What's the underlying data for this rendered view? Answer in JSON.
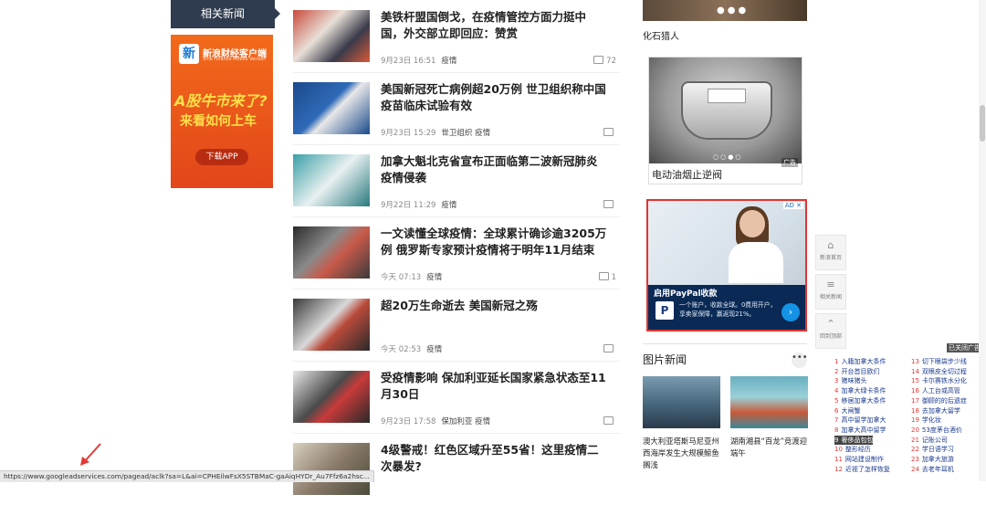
{
  "sidebar": {
    "tab_label": "相关新闻",
    "ad": {
      "logo_char": "新",
      "brand": "新浪财经客户端",
      "brand_en": "Sina Finance Mobile Version",
      "line1": "A股牛市来了?",
      "line2": "来看如何上车",
      "button": "下载APP"
    }
  },
  "news": [
    {
      "title": "美铁杆盟国倒戈，在疫情管控方面力挺中国，外交部立即回应：赞赏",
      "time": "9月23日 16:51",
      "tags": "疫情",
      "comments": "72"
    },
    {
      "title": "美国新冠死亡病例超20万例 世卫组织称中国疫苗临床试验有效",
      "time": "9月23日 15:29",
      "tags": "世卫组织  疫情",
      "comments": ""
    },
    {
      "title": "加拿大魁北克省宣布正面临第二波新冠肺炎疫情侵袭",
      "time": "9月22日 11:29",
      "tags": "疫情",
      "comments": ""
    },
    {
      "title": "一文读懂全球疫情：全球累计确诊逾3205万例 俄罗斯专家预计疫情将于明年11月结束",
      "time": "今天 07:13",
      "tags": "疫情",
      "comments": "1"
    },
    {
      "title": "超20万生命逝去 美国新冠之殇",
      "time": "今天 02:53",
      "tags": "疫情",
      "comments": ""
    },
    {
      "title": "受疫情影响 保加利亚延长国家紧急状态至11月30日",
      "time": "9月23日 17:58",
      "tags": "保加利亚  疫情",
      "comments": ""
    },
    {
      "title": "4级警戒！红色区域升至55省！这里疫情二次暴发?",
      "time": "",
      "tags": "",
      "comments": ""
    }
  ],
  "right": {
    "fossil_caption": "化石猎人",
    "pot_ad_caption": "电动油烟止逆阀",
    "pot_ad_tag": "广告",
    "paypal_ad": {
      "close": "AD ✕",
      "title": "启用PayPal收款",
      "desc": "一个账户，收款全球。0费用开户，享卖家保障，赢返现21%。",
      "icon": "P",
      "go": "›"
    },
    "pic_section_title": "图片新闻",
    "pic_more": "•••",
    "pic_news": [
      {
        "caption": "澳大利亚塔斯马尼亚州西海岸发生大规模鲸鱼搁浅"
      },
      {
        "caption": "湖南湘县“百龙”竞渡迎端午"
      }
    ]
  },
  "float_tools": [
    {
      "icon": "⌂",
      "label": "新浪首页"
    },
    {
      "icon": "≡",
      "label": "相关新闻"
    },
    {
      "icon": "⌃",
      "label": "回到顶部"
    }
  ],
  "ranking": {
    "close": "已关闭广告",
    "left": [
      {
        "n": "1",
        "t": "入籍加拿大条件"
      },
      {
        "n": "2",
        "t": "开台首目欧们"
      },
      {
        "n": "3",
        "t": "猪味猪头"
      },
      {
        "n": "4",
        "t": "加拿大绿卡条件"
      },
      {
        "n": "5",
        "t": "移居加拿大条件"
      },
      {
        "n": "6",
        "t": "大闸蟹"
      },
      {
        "n": "7",
        "t": "高中留学加拿大"
      },
      {
        "n": "8",
        "t": "加拿大高中留学"
      },
      {
        "n": "9",
        "t": "奢侈品包包"
      },
      {
        "n": "10",
        "t": "整形经历"
      },
      {
        "n": "11",
        "t": "网站建设制作"
      },
      {
        "n": "12",
        "t": "近视了怎样恢复"
      }
    ],
    "right": [
      {
        "n": "13",
        "t": "切下眼袋步少线"
      },
      {
        "n": "14",
        "t": "双眼皮全切过程"
      },
      {
        "n": "15",
        "t": "卡尔赛铁水分化"
      },
      {
        "n": "16",
        "t": "人工台或高管"
      },
      {
        "n": "17",
        "t": "御顾的的后遗症"
      },
      {
        "n": "18",
        "t": "去加拿大留学"
      },
      {
        "n": "19",
        "t": "学化妆"
      },
      {
        "n": "20",
        "t": "53度茅台酒价"
      },
      {
        "n": "21",
        "t": "记账公司"
      },
      {
        "n": "22",
        "t": "学日语学习"
      },
      {
        "n": "23",
        "t": "加拿大旅游"
      },
      {
        "n": "24",
        "t": "去老年耳机"
      }
    ]
  },
  "status_url": "https://www.googleadservices.com/pagead/aclk?sa=L&ai=CPHEilwFsX5STBMaC-gaAiqHYDr_Au7Ffz6a2hsc..."
}
